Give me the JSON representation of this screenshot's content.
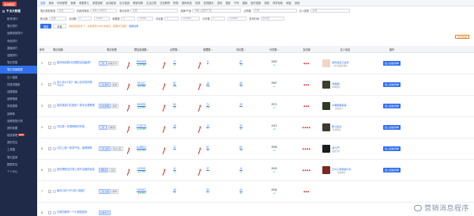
{
  "sidebar": {
    "logo": "营销数据",
    "group": "千瓜大数据",
    "items": [
      {
        "label": "帐号排行",
        "badge": "",
        "active": false
      },
      {
        "label": "笔记排行",
        "badge": "",
        "active": false
      },
      {
        "label": "品牌投放排行",
        "badge": "",
        "active": false
      },
      {
        "label": "商品排行",
        "badge": "",
        "active": false
      },
      {
        "label": "直播排行",
        "badge": "",
        "active": false
      },
      {
        "label": "话题排行",
        "badge": "",
        "active": false
      },
      {
        "label": "笔记热搜",
        "badge": "",
        "active": false
      },
      {
        "label": "笔记流量趋势",
        "badge": "",
        "active": true
      },
      {
        "label": "达人搜索",
        "badge": "",
        "active": false
      },
      {
        "label": "热搜词搜索",
        "badge": "",
        "active": false
      },
      {
        "label": "话题搜索",
        "badge": "",
        "active": false
      },
      {
        "label": "品牌搜索",
        "badge": "",
        "active": false
      },
      {
        "label": "商品搜索",
        "badge": "",
        "active": false
      },
      {
        "label": "品牌库",
        "badge": "",
        "active": false
      },
      {
        "label": "品牌投放分析",
        "badge": "",
        "active": false
      },
      {
        "label": "我的收藏",
        "badge": "",
        "active": false
      },
      {
        "label": "投放管理",
        "badge": "NEW",
        "active": false
      },
      {
        "label": "我的关注",
        "badge": "",
        "active": false
      },
      {
        "label": "工具箱",
        "badge": "",
        "active": false
      },
      {
        "label": "笔记监测",
        "badge": "",
        "active": false
      },
      {
        "label": "数据导出",
        "badge": "",
        "active": false
      },
      {
        "label": "个人中心",
        "badge": "",
        "active": false
      }
    ]
  },
  "topnav": {
    "tabs": [
      "全部",
      "美妆",
      "时尚穿搭",
      "美食",
      "母婴育儿",
      "家居装修",
      "运动健身",
      "出行旅游",
      "萌宠动物",
      "生活日常",
      "文化教育",
      "职场",
      "数码科技",
      "情感",
      "影视娱乐",
      "游戏",
      "摄影",
      "汽车",
      "婚嫁",
      "医疗健康",
      "搞笑",
      "科学探索",
      "明星",
      "其他"
    ],
    "active_index": 0
  },
  "filters": {
    "row1": {
      "label_type": "笔记类型筛选",
      "type_value": "全部",
      "label_kw": "关键词筛选",
      "kw_placeholder": "请输入关键词",
      "label_tag": "笔记标签",
      "tag_placeholder": "全部",
      "label_brand": "品牌/产品",
      "brand_placeholder": "请输入品牌/产品",
      "label_likes": "点赞数",
      "likes_placeholder": "不限",
      "label_blogger": "达人类型",
      "blogger_value": "全部"
    },
    "row2": {
      "label_fans": "粉丝数",
      "fans_value": "全部",
      "label_interact": "互动数",
      "interact_min": "0",
      "interact_max": "10000",
      "label_coll": "收藏数",
      "coll_min": "0",
      "coll_max": "10000",
      "label_comment": "评论数",
      "comment_min": "0",
      "comment_max": "100000",
      "label_share": "分享数",
      "share_min": "0",
      "share_max": "100000",
      "label_time": "发布时间",
      "time_value": "近30天"
    },
    "search": "搜索",
    "reset": "重置",
    "tip": "当前筛选条件下，共搜索到 1000 条笔记，结果均已展示",
    "tip2": "数据说明",
    "export": "导出数据"
  },
  "table": {
    "headers": [
      "序号",
      "",
      "笔记标题",
      "笔记标签",
      "预估阅读数 ↓",
      "点赞数 ↓",
      "收藏数 ↓",
      "评论数 ↓",
      "分享数 ↓",
      "互动量",
      "达人信息",
      "操作"
    ],
    "rows": [
      {
        "idx": "1",
        "title": "如何用这款口红搭配出高级感？",
        "tags": [
          "口红",
          "彩妆分享"
        ],
        "price": "5952835",
        "price_sub": "▲27,386",
        "rank": "71",
        "rank_sub": "+1",
        "fav": "6",
        "fav_sub": "-",
        "pv": "47",
        "pv_sub": "+2",
        "views": "3392",
        "views_sub": "+1",
        "ind": "◆◆◆",
        "author": "我吃我自己喜欢",
        "adesc": "小红书美妆博主",
        "acolor": "#f1d6c7",
        "act": "加入投放清单"
      },
      {
        "idx": "2",
        "title": "怎么评价口红？我心目中的好物TOP3",
        "tags": [
          "口红推荐",
          "彩妆"
        ],
        "price": "767417",
        "price_sub": "▲1,538",
        "rank": "87",
        "rank_sub": "+44",
        "fav": "16",
        "fav_sub": "+13",
        "pv": "46",
        "pv_sub": "+3",
        "views": "2987",
        "views_sub": "+1",
        "ind": "◆◆◆",
        "author": "唯甜甜",
        "adesc": "时尚博主",
        "acolor": "#3a3f2c",
        "act": "加入投放清单"
      },
      {
        "idx": "3",
        "title": "如何挑选口红颜色？新手必看教程",
        "tags": [
          "彩妆教程",
          "新手"
        ],
        "price": "651593",
        "price_sub": "▲2,084",
        "rank": "84",
        "rank_sub": "+2",
        "fav": "71",
        "fav_sub": "+71",
        "pv": "30",
        "pv_sub": "-",
        "views": "2974",
        "views_sub": "+1",
        "ind": "◆◆◆",
        "author": "大眼睛要美美",
        "adesc": "美妆达人",
        "acolor": "#2d3b24",
        "act": "加入投放清单"
      },
      {
        "idx": "4",
        "title": "口红是一件很神奇的东西",
        "tags": [
          "口红",
          "日常妆"
        ],
        "price": "1728770",
        "price_sub": "▲31,005",
        "rank": "18",
        "rank_sub": "-",
        "fav": "14",
        "fav_sub": "-",
        "pv": "34",
        "pv_sub": "+1",
        "views": "4112",
        "views_sub": "+9",
        "ind": "◆◆◆◆",
        "author": "那么如此",
        "adesc": "生活博主",
        "acolor": "#3b3b2f",
        "act": "加入投放清单"
      },
      {
        "idx": "5",
        "title": "口红上唇一秒变气色，值得拥有",
        "tags": [
          "口红试色",
          "平价口红"
        ],
        "price": "1248671",
        "price_sub": "▲21,361",
        "rank": "11",
        "rank_sub": "-",
        "fav": "57",
        "fav_sub": "+1",
        "pv": "52",
        "pv_sub": "+2",
        "views": "3998",
        "views_sub": "+1",
        "ind": "◆◆◆◆",
        "author": "我不严",
        "adesc": "美妆分享",
        "acolor": "#1c1c1c",
        "act": "加入投放清单"
      },
      {
        "idx": "6",
        "title": "如何搭配出日常上班不出错的妆容",
        "tags": [
          "通勤妆",
          "口红"
        ],
        "price": "132049",
        "price_sub": "▲1,023",
        "rank": "11",
        "rank_sub": "+1",
        "fav": "37",
        "fav_sub": "-",
        "pv": "11",
        "pv_sub": "+1",
        "views": "3040",
        "views_sub": "+1",
        "ind": "◆◆◆◆",
        "author": "王叶子青很懒不好",
        "adesc": "彩妆博主",
        "acolor": "#7a2a20",
        "act": "加入投放清单"
      },
      {
        "idx": "7",
        "title": "每天口红TOP3怎么挑选？",
        "tags": [
          "口红合集",
          "种草"
        ],
        "price": "1184001",
        "price_sub": "▲8,411",
        "rank": "48",
        "rank_sub": "-",
        "fav": "50",
        "fav_sub": "-",
        "pv": "43",
        "pv_sub": "+1",
        "views": "2946",
        "views_sub": "+2",
        "ind": "◆◆◆",
        "author": "",
        "adesc": "",
        "acolor": "#f0f0f0",
        "act": ""
      },
      {
        "idx": "8",
        "title": "日常的我有一个小秘密给你",
        "tags": [
          "好物分享"
        ],
        "price": "",
        "price_sub": "",
        "rank": "",
        "rank_sub": "",
        "fav": "",
        "fav_sub": "",
        "pv": "",
        "pv_sub": "",
        "views": "",
        "views_sub": "",
        "ind": "",
        "author": "",
        "adesc": "",
        "acolor": "#f0f0f0",
        "act": ""
      }
    ]
  },
  "watermark": "营销消息程序",
  "colors": {
    "accent": "#2f6fed",
    "sidebar_bg": "#1e2a47",
    "annotation": "#d92b2b",
    "positive": "#27ae60"
  }
}
